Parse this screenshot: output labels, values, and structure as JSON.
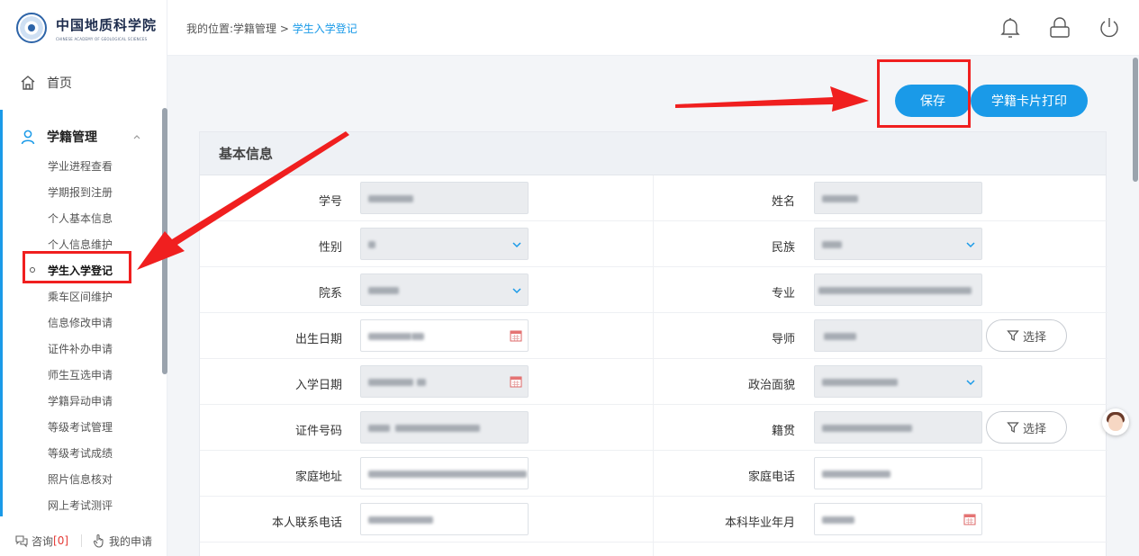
{
  "logo": {
    "name": "中国地质科学院",
    "subtitle": "CHINESE ACADEMY OF GEOLOGICAL SCIENCES"
  },
  "breadcrumb": {
    "prefix": "我的位置:学籍管理 > ",
    "current": "学生入学登记"
  },
  "sidebar": {
    "home": "首页",
    "group": "学籍管理",
    "items": [
      "学业进程查看",
      "学期报到注册",
      "个人基本信息",
      "个人信息维护",
      "学生入学登记",
      "乘车区间维护",
      "信息修改申请",
      "证件补办申请",
      "师生互选申请",
      "学籍异动申请",
      "等级考试管理",
      "等级考试成绩",
      "照片信息核对",
      "网上考试测评"
    ],
    "active_index": 4,
    "footer": {
      "consult": "咨询",
      "consult_count": "[0]",
      "mine": "我的申请"
    }
  },
  "actions": {
    "save": "保存",
    "print": "学籍卡片打印"
  },
  "form": {
    "section_title": "基本信息",
    "select_label": "选择",
    "left_labels": [
      "学号",
      "性别",
      "院系",
      "出生日期",
      "入学日期",
      "证件号码",
      "家庭地址",
      "本人联系电话"
    ],
    "right_labels": [
      "姓名",
      "民族",
      "专业",
      "导师",
      "政治面貌",
      "籍贯",
      "家庭电话",
      "本科毕业年月"
    ]
  },
  "colors": {
    "accent": "#1a9ae8",
    "highlight": "#f01f1f"
  }
}
